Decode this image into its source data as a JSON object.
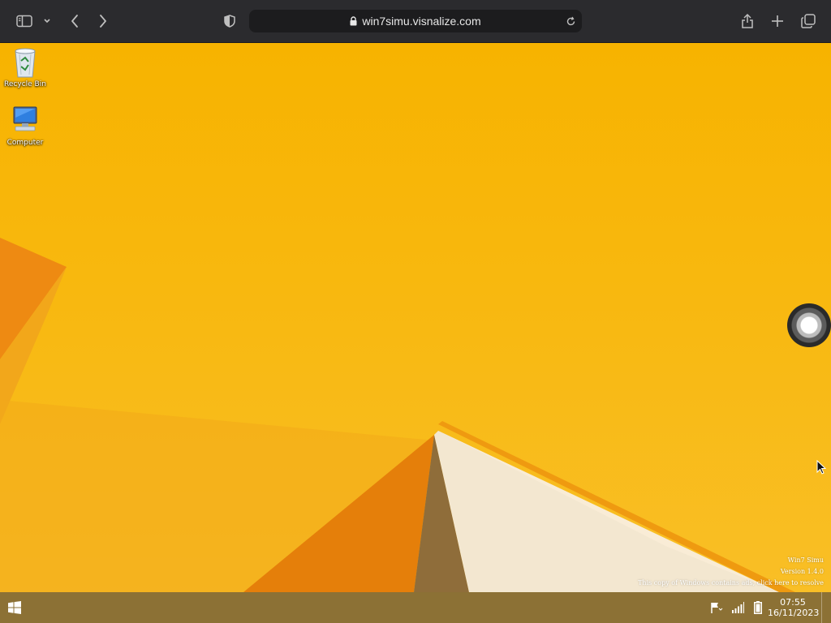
{
  "browser": {
    "url": "win7simu.visnalize.com",
    "icons": {
      "sidebar": "sidebar-icon",
      "tabs_menu": "chevron-down-icon",
      "back": "back-arrow-icon",
      "forward": "forward-arrow-icon",
      "privacy": "shield-icon",
      "lock": "lock-icon",
      "reload": "reload-icon",
      "share": "share-icon",
      "new_tab": "plus-icon",
      "tab_overview": "tabs-icon"
    }
  },
  "desktop": {
    "icons": [
      {
        "label": "Recycle Bin",
        "icon": "recycle-bin-icon"
      },
      {
        "label": "Computer",
        "icon": "computer-icon"
      }
    ],
    "watermark": {
      "title": "Win7 Simu",
      "version": "Version 1.4.0",
      "notice": "This copy of Windows contains ads, click here to resolve"
    },
    "accent_color": "#f7b300"
  },
  "taskbar": {
    "clock_time": "07:55",
    "clock_date": "16/11/2023",
    "tray": [
      "flag-icon",
      "signal-icon",
      "battery-icon"
    ],
    "color": "#8c7135"
  }
}
